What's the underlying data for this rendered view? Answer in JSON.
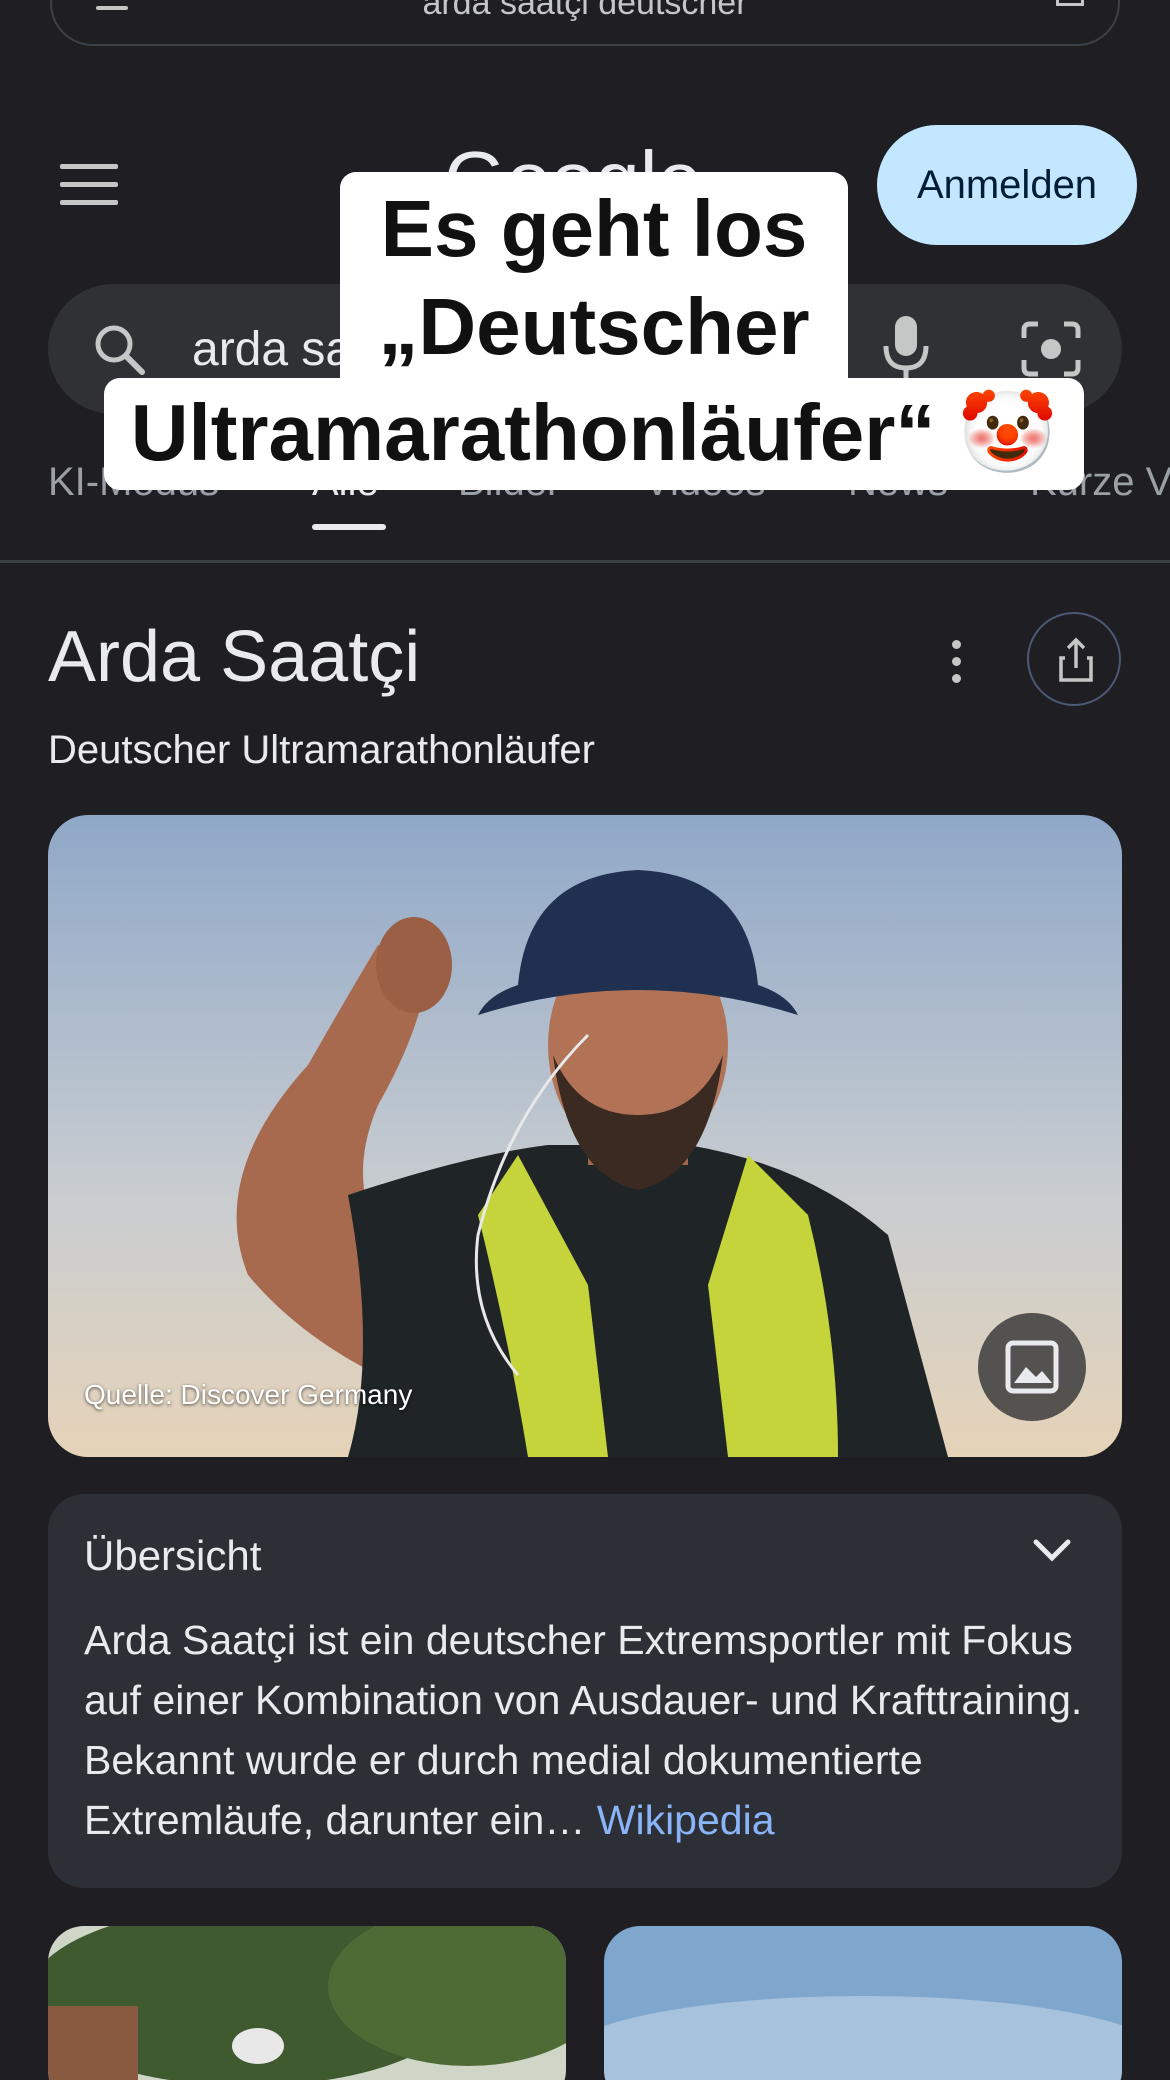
{
  "browser": {
    "url_text": "arda saatçi deutscher"
  },
  "header": {
    "logo_text": "Google",
    "signin_label": "Anmelden"
  },
  "search": {
    "query": "arda sa"
  },
  "tabs": [
    {
      "label": "KI-Modus"
    },
    {
      "label": "Alle"
    },
    {
      "label": "Bilder"
    },
    {
      "label": "Videos"
    },
    {
      "label": "News"
    },
    {
      "label": "Kurze V"
    }
  ],
  "caption": {
    "line1": "Es geht los",
    "line2": "„Deutscher",
    "line3": "Ultramarathonläufer“ 🤡"
  },
  "panel": {
    "title": "Arda Saatçi",
    "subtitle": "Deutscher Ultramarathonläufer",
    "image_source": "Quelle: Discover Germany"
  },
  "overview": {
    "heading": "Übersicht",
    "body": "Arda Saatçi ist ein deutscher Extremsportler mit Fokus auf einer Kombination von Ausdauer- und Krafttraining. Bekannt wurde er durch medial dokumentierte Extremläufe, darunter ein…",
    "link": "Wikipedia"
  },
  "colors": {
    "background": "#1f1f23",
    "signin_bg": "#c2e7ff",
    "link": "#8ab4f8"
  },
  "icons": [
    "menu-icon",
    "mic-icon",
    "lens-icon",
    "search-icon",
    "more-vert-icon",
    "share-icon",
    "image-icon",
    "chevron-down-icon"
  ]
}
